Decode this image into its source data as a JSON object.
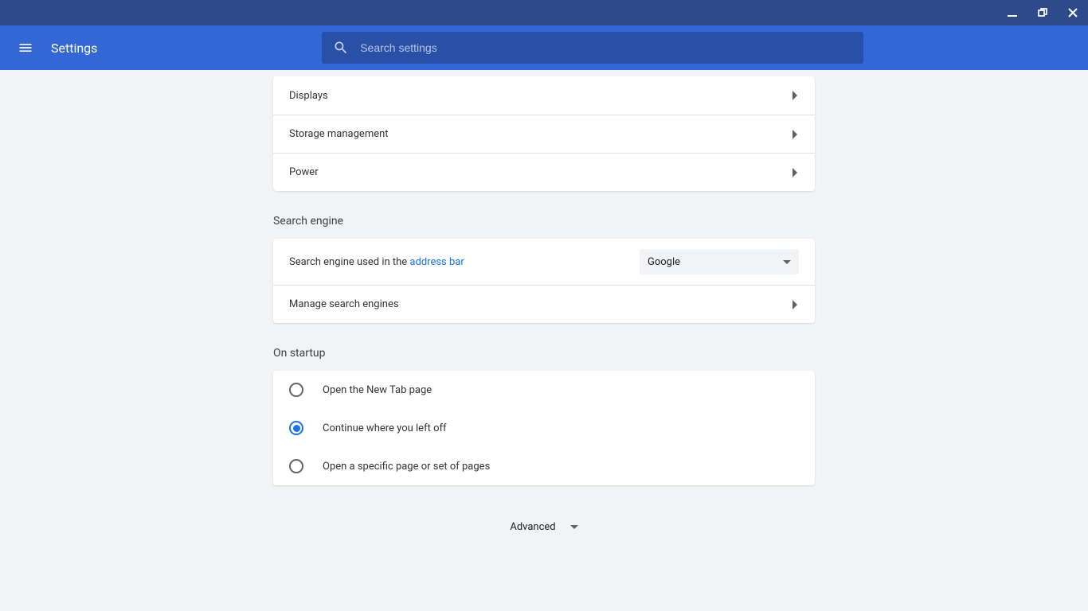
{
  "header": {
    "title": "Settings",
    "search_placeholder": "Search settings"
  },
  "device_section": {
    "items": [
      {
        "label": "Displays"
      },
      {
        "label": "Storage management"
      },
      {
        "label": "Power"
      }
    ]
  },
  "search_engine_section": {
    "title": "Search engine",
    "used_in_text": "Search engine used in the ",
    "address_bar_link": "address bar",
    "selected_engine": "Google",
    "manage_label": "Manage search engines"
  },
  "startup_section": {
    "title": "On startup",
    "options": [
      {
        "label": "Open the New Tab page",
        "selected": false
      },
      {
        "label": "Continue where you left off",
        "selected": true
      },
      {
        "label": "Open a specific page or set of pages",
        "selected": false
      }
    ]
  },
  "advanced_label": "Advanced"
}
